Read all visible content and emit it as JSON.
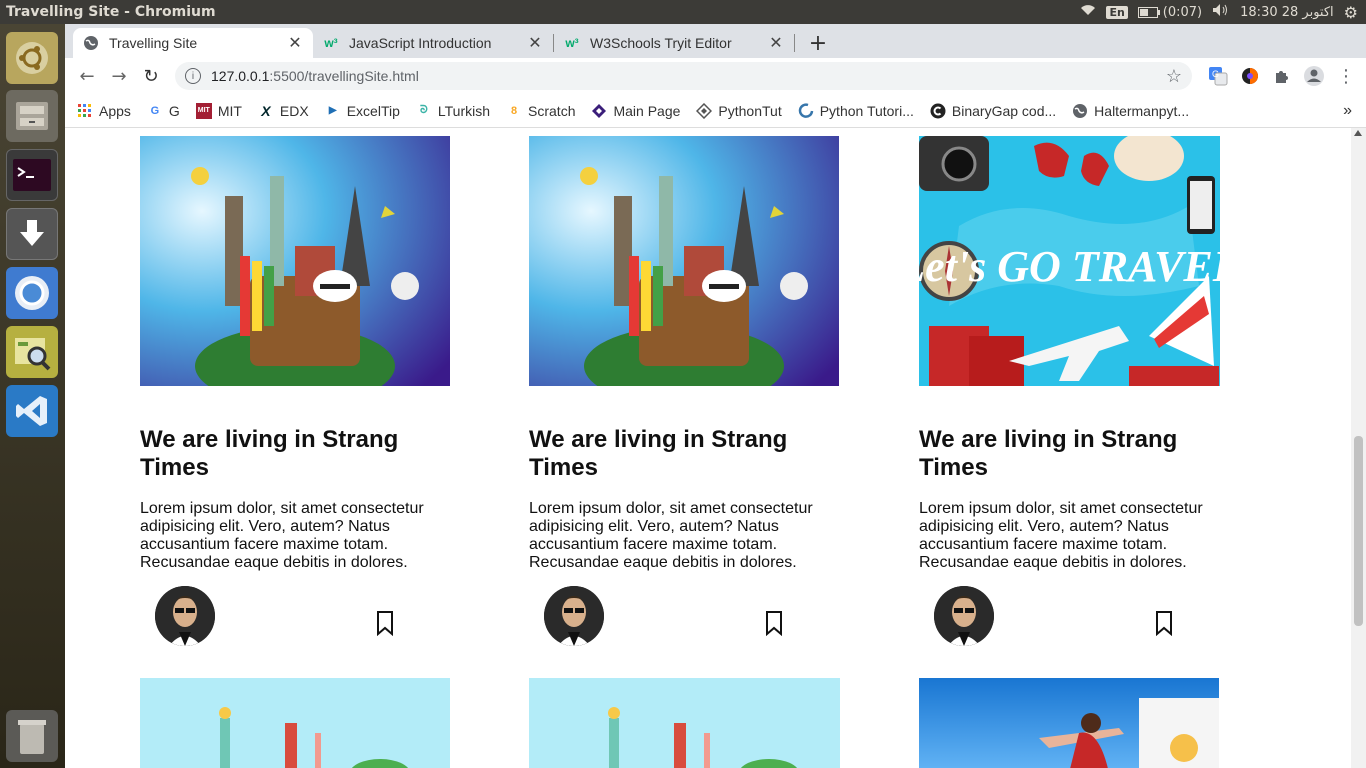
{
  "system": {
    "window_title": "Travelling Site - Chromium",
    "keyboard_lang": "En",
    "battery": "(0:07)",
    "clock": "18:30 28 اکتوبر"
  },
  "tabs": [
    {
      "label": "Travelling Site",
      "icon": "globe-icon"
    },
    {
      "label": "JavaScript Introduction",
      "icon": "w3schools-icon"
    },
    {
      "label": "W3Schools Tryit Editor",
      "icon": "w3schools-icon"
    }
  ],
  "address": {
    "host": "127.0.0.1",
    "path": ":5500/travellingSite.html"
  },
  "bookmarks": [
    {
      "label": "Apps",
      "icon": "apps-grid-icon"
    },
    {
      "label": "G",
      "icon": "google-icon"
    },
    {
      "label": "MIT",
      "icon": "mit-icon"
    },
    {
      "label": "EDX",
      "icon": "edx-icon"
    },
    {
      "label": "ExcelTip",
      "icon": "exceltip-icon"
    },
    {
      "label": "LTurkish",
      "icon": "lturkish-icon"
    },
    {
      "label": "Scratch",
      "icon": "scratch-icon"
    },
    {
      "label": "Main Page",
      "icon": "mainpage-icon"
    },
    {
      "label": "PythonTut",
      "icon": "pythontut-icon"
    },
    {
      "label": "Python Tutori...",
      "icon": "python-tutorial-icon"
    },
    {
      "label": "BinaryGap cod...",
      "icon": "codility-icon"
    },
    {
      "label": "Haltermanpyt...",
      "icon": "globe-icon"
    }
  ],
  "cards": [
    {
      "title": "We are living in Strang Times",
      "text": "Lorem ipsum dolor, sit amet consectetur adipisicing elit. Vero, autem? Natus accusantium facere maxime totam. Recusandae eaque debitis in dolores."
    },
    {
      "title": "We are living in Strang Times",
      "text": "Lorem ipsum dolor, sit amet consectetur adipisicing elit. Vero, autem? Natus accusantium facere maxime totam. Recusandae eaque debitis in dolores."
    },
    {
      "title": "We are living in Strang Times",
      "text": "Lorem ipsum dolor, sit amet consectetur adipisicing elit. Vero, autem? Natus accusantium facere maxime totam. Recusandae eaque debitis in dolores."
    }
  ],
  "card3_image_text": "Let's GO TRAVEL",
  "colors": {
    "ubuntu_topbar": "#3c3b37",
    "chrome_frame": "#dee1e6",
    "sky_blue": "#2bc1e8"
  }
}
